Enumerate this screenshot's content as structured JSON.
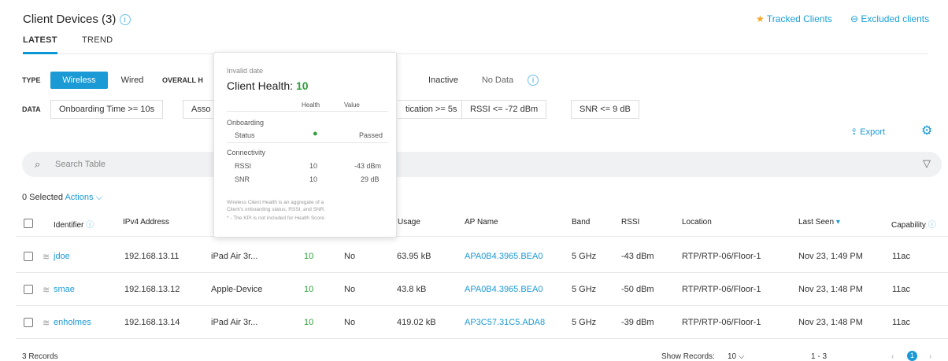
{
  "header": {
    "title": "Client Devices (3)",
    "tracked": "Tracked Clients",
    "excluded": "Excluded clients"
  },
  "tabs": [
    "LATEST",
    "TREND"
  ],
  "filters": {
    "type_label": "TYPE",
    "wireless": "Wireless",
    "wired": "Wired",
    "overall_label": "OVERALL H",
    "inactive": "Inactive",
    "nodata": "No Data",
    "data_label": "DATA",
    "chips": [
      "Onboarding Time >= 10s",
      "Asso",
      "tication >= 5s",
      "RSSI <= -72 dBm",
      "SNR <= 9 dB"
    ]
  },
  "toolbar": {
    "export": "Export",
    "search_placeholder": "Search Table",
    "selected": "0 Selected",
    "actions": "Actions"
  },
  "columns": [
    "Identifier",
    "IPv4 Address",
    "Usage",
    "AP Name",
    "Band",
    "RSSI",
    "Location",
    "Last Seen",
    "Capability"
  ],
  "rows": [
    {
      "id": "jdoe",
      "ip": "192.168.13.11",
      "device": "iPad Air 3r...",
      "health": "10",
      "flag": "No",
      "usage": "63.95 kB",
      "ap": "APA0B4.3965.BEA0",
      "band": "5 GHz",
      "rssi": "-43 dBm",
      "location": "RTP/RTP-06/Floor-1",
      "seen": "Nov 23, 1:49 PM",
      "cap": "11ac"
    },
    {
      "id": "smae",
      "ip": "192.168.13.12",
      "device": "Apple-Device",
      "health": "10",
      "flag": "No",
      "usage": "43.8 kB",
      "ap": "APA0B4.3965.BEA0",
      "band": "5 GHz",
      "rssi": "-50 dBm",
      "location": "RTP/RTP-06/Floor-1",
      "seen": "Nov 23, 1:48 PM",
      "cap": "11ac"
    },
    {
      "id": "enholmes",
      "ip": "192.168.13.14",
      "device": "iPad Air 3r...",
      "health": "10",
      "flag": "No",
      "usage": "419.02 kB",
      "ap": "AP3C57.31C5.ADA8",
      "band": "5 GHz",
      "rssi": "-39 dBm",
      "location": "RTP/RTP-06/Floor-1",
      "seen": "Nov 23, 1:48 PM",
      "cap": "11ac"
    }
  ],
  "popover": {
    "date": "Invalid date",
    "title": "Client Health:",
    "score": "10",
    "col_health": "Health",
    "col_value": "Value",
    "onboarding": "Onboarding",
    "status": "Status",
    "status_value": "Passed",
    "connectivity": "Connectivity",
    "rssi": "RSSI",
    "rssi_health": "10",
    "rssi_value": "-43 dBm",
    "snr": "SNR",
    "snr_health": "10",
    "snr_value": "29 dB",
    "note1": "Wireless Client Health is an aggregate of a",
    "note2": "Client's onboarding status, RSSI, and SNR.",
    "note3": "* - The KPI is not included for Health Score"
  },
  "footer": {
    "records": "3 Records",
    "show_label": "Show Records:",
    "show_value": "10",
    "range": "1 - 3",
    "page": "1"
  }
}
